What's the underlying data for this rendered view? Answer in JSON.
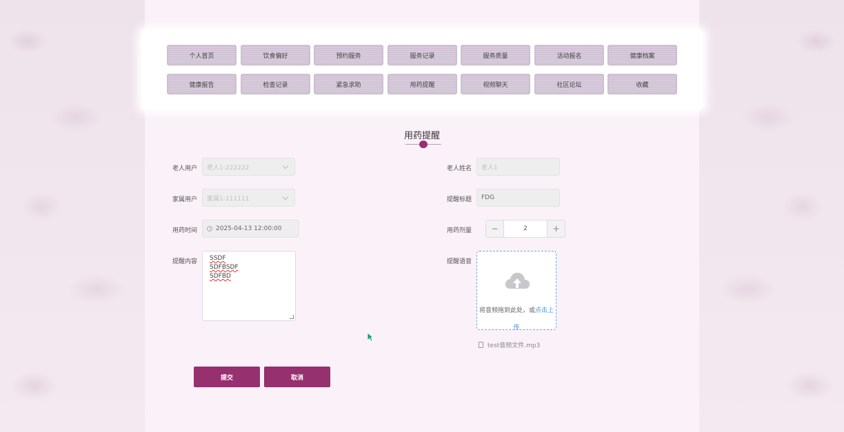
{
  "nav": {
    "row1": [
      "个人首页",
      "饮食偏好",
      "预约服务",
      "服务记录",
      "服务质量",
      "活动报名",
      "健康档案"
    ],
    "row2": [
      "健康报告",
      "检查记录",
      "紧急求助",
      "用药提醒",
      "视频聊天",
      "社区论坛",
      "收藏"
    ]
  },
  "page": {
    "title": "用药提醒"
  },
  "form": {
    "elder_user": {
      "label": "老人用户",
      "value": "老人1-222222"
    },
    "elder_name": {
      "label": "老人姓名",
      "value": "老人1"
    },
    "family_user": {
      "label": "家属用户",
      "value": "家属1-111111"
    },
    "reminder_title": {
      "label": "提醒标题",
      "value": "FDG"
    },
    "med_time": {
      "label": "用药时间",
      "value": "2025-04-13 12:00:00"
    },
    "dosage": {
      "label": "用药剂量",
      "value": "2",
      "minus": "−",
      "plus": "+"
    },
    "content": {
      "label": "提醒内容",
      "lines": [
        "SSDF",
        "SDFBSDF",
        "SDFBD"
      ]
    },
    "voice": {
      "label": "提醒语音",
      "drop_text": "将音频拖到此处，或",
      "click_text": "点击上传",
      "file_name": "test音频文件.mp3"
    }
  },
  "actions": {
    "submit": "提交",
    "cancel": "取消"
  },
  "colors": {
    "accent": "#96306f",
    "link": "#4a90d9"
  },
  "icons": [
    "chevron-down-icon",
    "clock-icon",
    "cloud-upload-icon",
    "document-icon",
    "cursor-icon"
  ]
}
